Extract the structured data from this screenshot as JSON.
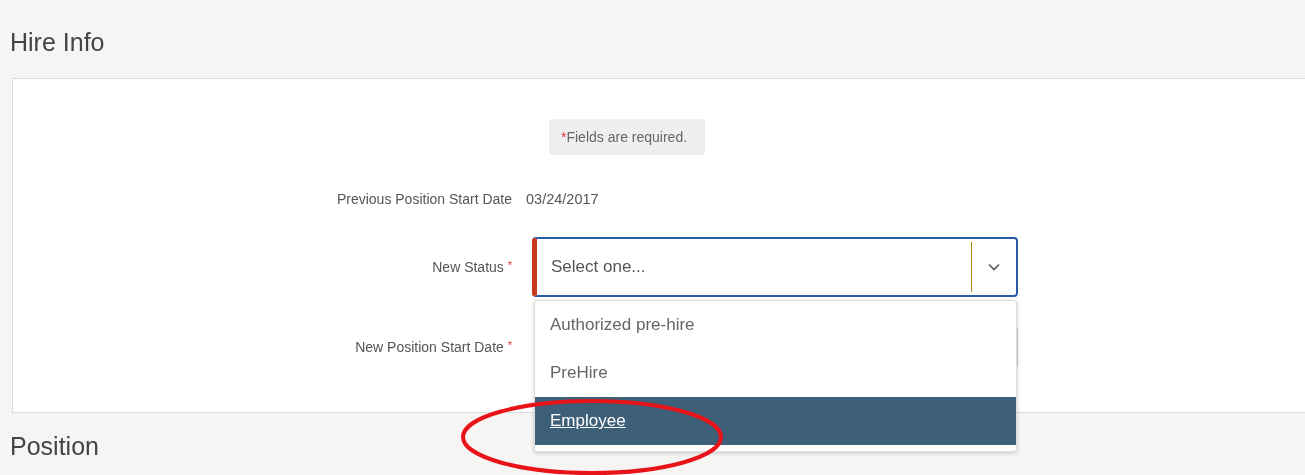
{
  "section_title": "Hire Info",
  "notice": {
    "marker": "*",
    "text": "Fields are required."
  },
  "required_mark": "*",
  "fields": [
    {
      "kind": "text",
      "label": "Previous Position Start Date",
      "required": false,
      "value": "03/24/2017"
    },
    {
      "kind": "select",
      "label": "New Status",
      "required": true,
      "placeholder": "Select one...",
      "expanded": true,
      "options": [
        {
          "label": "Authorized pre-hire",
          "selected": false
        },
        {
          "label": "PreHire",
          "selected": false
        },
        {
          "label": "Employee",
          "selected": true
        }
      ]
    },
    {
      "kind": "date",
      "label": "New Position Start Date",
      "required": true
    }
  ],
  "next_section_title": "Position"
}
